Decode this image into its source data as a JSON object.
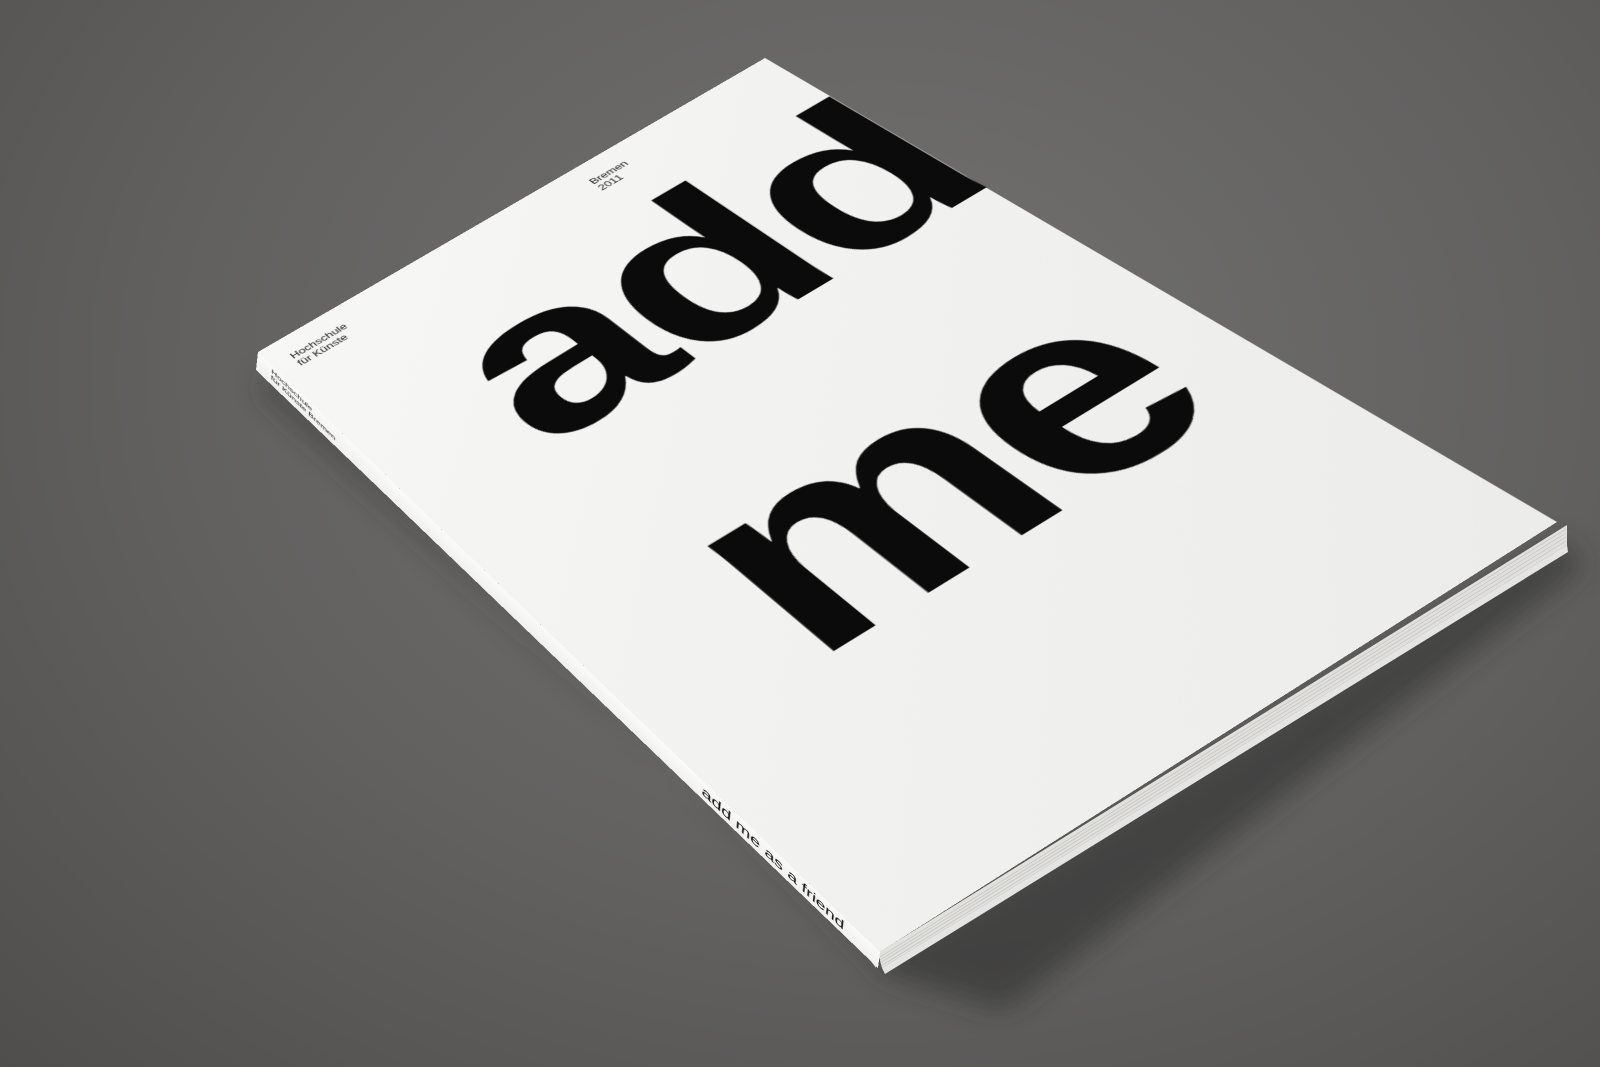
{
  "photo": {
    "subject": "book",
    "background_color": "#666564",
    "cover_color": "#f3f3f2",
    "ink_color": "#0b0b0b"
  },
  "cover": {
    "headline_line1": "add",
    "headline_line2": "me",
    "institution_line1": "Hochschule",
    "institution_line2": "für Künste",
    "city": "Bremen",
    "year": "2011"
  },
  "spine": {
    "title": "add me as a friend",
    "publisher_line1": "Hochschule",
    "publisher_line2": "für Künste Bremen"
  }
}
